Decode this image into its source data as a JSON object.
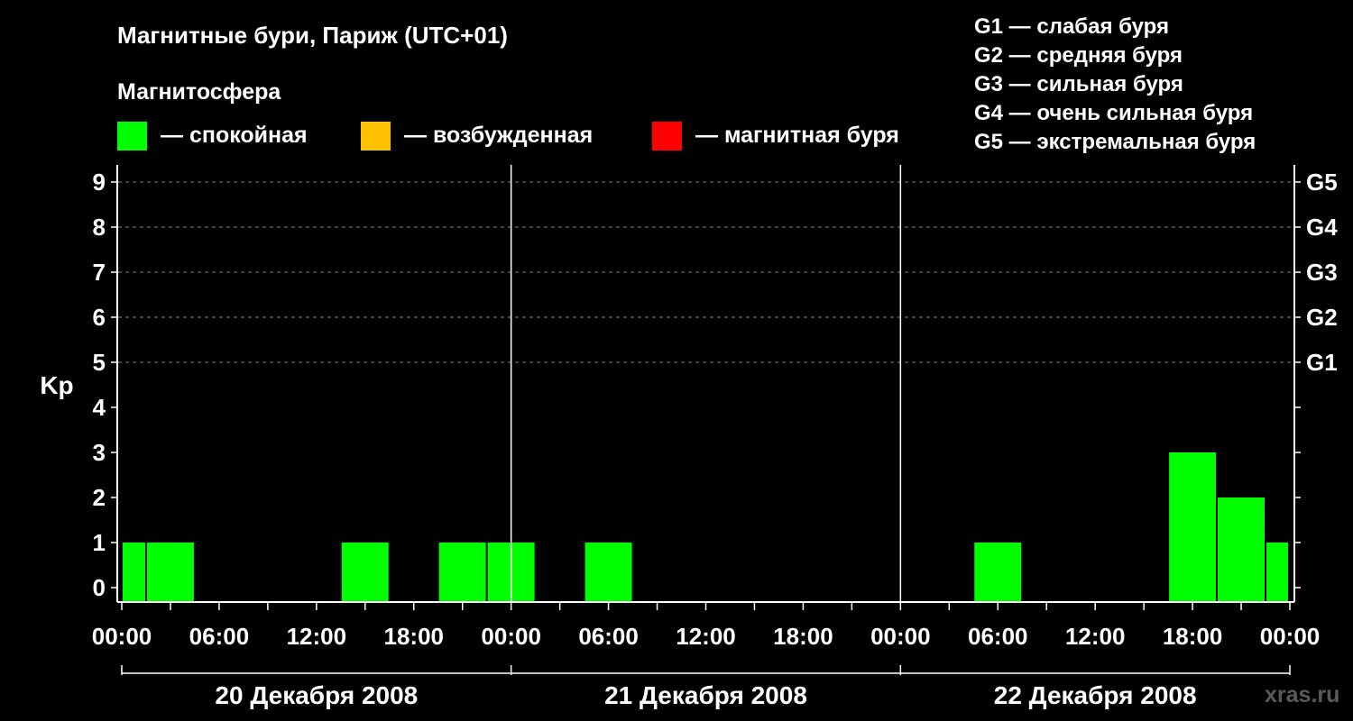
{
  "title": "Магнитные бури, Париж (UTC+01)",
  "legend": {
    "header": "Магнитосфера",
    "items": [
      {
        "label": "— спокойная",
        "color": "#00ff00"
      },
      {
        "label": "— возбужденная",
        "color": "#ffc000"
      },
      {
        "label": "— магнитная буря",
        "color": "#ff0000"
      }
    ]
  },
  "storm_levels": [
    "G1 — слабая буря",
    "G2 — средняя буря",
    "G3 — сильная буря",
    "G4 — очень сильная буря",
    "G5 — экстремальная буря"
  ],
  "watermark": "xras.ru",
  "colors": {
    "background": "#000000",
    "foreground": "#ffffff",
    "grid": "#888888",
    "quiet": "#00ff00",
    "watermark": "#5a5a5a"
  },
  "chart_data": {
    "type": "bar",
    "ylabel": "Kp",
    "ylim": [
      0,
      9
    ],
    "y_ticks": [
      "0",
      "1",
      "2",
      "3",
      "4",
      "5",
      "6",
      "7",
      "8",
      "9"
    ],
    "right_ticks": [
      {
        "kp": 5,
        "label": "G1"
      },
      {
        "kp": 6,
        "label": "G2"
      },
      {
        "kp": 7,
        "label": "G3"
      },
      {
        "kp": 8,
        "label": "G4"
      },
      {
        "kp": 9,
        "label": "G5"
      }
    ],
    "x_ticks": [
      "00:00",
      "06:00",
      "12:00",
      "18:00",
      "00:00",
      "06:00",
      "12:00",
      "18:00",
      "00:00",
      "06:00",
      "12:00",
      "18:00",
      "00:00"
    ],
    "days": [
      "20 Декабря 2008",
      "21 Декабря 2008",
      "22 Декабря 2008"
    ],
    "grid": "dashed horizontal lines at Kp 5-9",
    "bar_interval_hours": 3,
    "series": [
      {
        "values": [
          1,
          1,
          0,
          0,
          0,
          1,
          0,
          1,
          1,
          0,
          1,
          0,
          0,
          0,
          0,
          0,
          0,
          0,
          1,
          0,
          0,
          0,
          3,
          2,
          1
        ]
      }
    ]
  }
}
